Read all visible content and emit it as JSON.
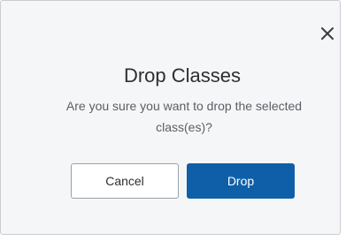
{
  "dialog": {
    "title": "Drop Classes",
    "message": "Are you sure you want to drop the selected class(es)?",
    "close_icon": "close-icon",
    "cancel_label": "Cancel",
    "drop_label": "Drop"
  },
  "colors": {
    "primary": "#0f5fa8",
    "modal_background": "#f5f6f7",
    "title_text": "#2c2f33",
    "message_text": "#5a5f66"
  }
}
